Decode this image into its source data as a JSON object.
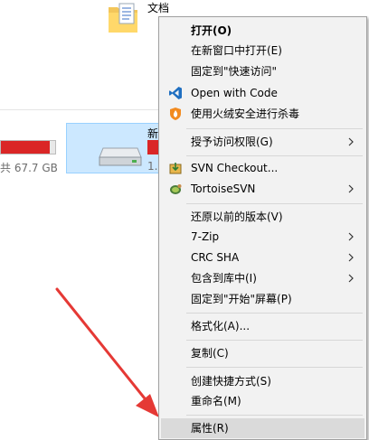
{
  "explorer": {
    "folder_label": "文档",
    "drive_free_text": "共 67.7 GB",
    "drive2_name": "新",
    "drive2_free_text": "1.",
    "drive1_usage_fraction": 0.9,
    "drive2_usage_fraction": 1.0
  },
  "colors": {
    "menu_bg": "#f2f2f2",
    "hover_bg": "#dadada",
    "selection_tile": "#cce8ff",
    "usage_bar": "#da2626",
    "arrow": "#e53935",
    "vscode_blue": "#1f6fc1"
  },
  "menu": {
    "items": [
      {
        "label": "打开(O)",
        "bold": true
      },
      {
        "label": "在新窗口中打开(E)"
      },
      {
        "label": "固定到\"快速访问\""
      },
      {
        "label": "Open with Code",
        "icon": "vscode-icon"
      },
      {
        "label": "使用火绒安全进行杀毒",
        "icon": "huorong-shield-icon"
      },
      {
        "label": "授予访问权限(G)",
        "submenu": true
      },
      {
        "label": "SVN Checkout...",
        "icon": "svn-checkout-icon"
      },
      {
        "label": "TortoiseSVN",
        "icon": "tortoisesvn-icon",
        "submenu": true
      },
      {
        "label": "还原以前的版本(V)"
      },
      {
        "label": "7-Zip",
        "submenu": true
      },
      {
        "label": "CRC SHA",
        "submenu": true
      },
      {
        "label": "包含到库中(I)",
        "submenu": true
      },
      {
        "label": "固定到\"开始\"屏幕(P)"
      },
      {
        "label": "格式化(A)..."
      },
      {
        "label": "复制(C)"
      },
      {
        "label": "创建快捷方式(S)"
      },
      {
        "label": "重命名(M)"
      },
      {
        "label": "属性(R)",
        "highlighted": true
      }
    ]
  }
}
